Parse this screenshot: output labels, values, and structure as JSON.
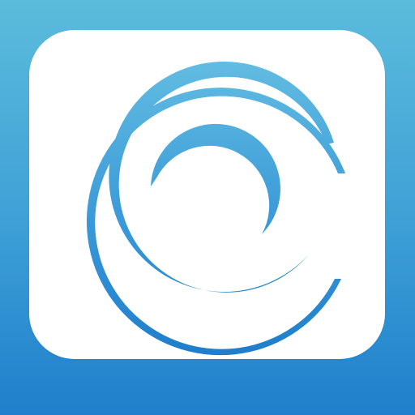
{
  "icon": {
    "name": "spiral-logo-icon",
    "colors": {
      "background_top": "#5cbcdc",
      "background_bottom": "#1f7fcc",
      "tile": "#ffffff",
      "spiral_light": "#63bde2",
      "spiral_dark": "#1f7fcc"
    }
  }
}
